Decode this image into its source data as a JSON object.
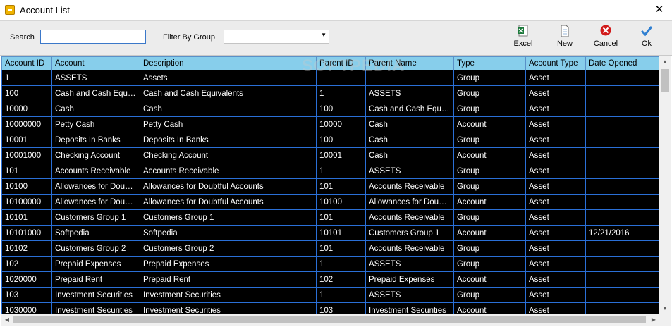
{
  "window": {
    "title": "Account List",
    "close_glyph": "✕"
  },
  "toolbar": {
    "search_label": "Search",
    "search_value": "",
    "filter_label": "Filter By Group",
    "filter_value": "",
    "buttons": [
      {
        "label": "Excel",
        "icon": "excel-icon"
      },
      {
        "label": "New",
        "icon": "new-document-icon"
      },
      {
        "label": "Cancel",
        "icon": "cancel-icon"
      },
      {
        "label": "Ok",
        "icon": "checkmark-icon"
      }
    ]
  },
  "colors": {
    "header_bg": "#87CEEB",
    "grid_bg": "#000000",
    "grid_line": "#2A6FD6",
    "cell_text": "#FFFFFF"
  },
  "watermark": "SOFTPEDIA",
  "table": {
    "columns": [
      "Account ID",
      "Account",
      "Description",
      "Parent ID",
      "Parent Name",
      "Type",
      "Account Type",
      "Date Opened"
    ],
    "rows": [
      [
        "1",
        "ASSETS",
        "Assets",
        "",
        "",
        "Group",
        "Asset",
        ""
      ],
      [
        "100",
        "Cash and Cash Equiva...",
        "Cash and Cash Equivalents",
        "1",
        "ASSETS",
        "Group",
        "Asset",
        ""
      ],
      [
        "10000",
        "Cash",
        "Cash",
        "100",
        "Cash and Cash Equiva...",
        "Group",
        "Asset",
        ""
      ],
      [
        "10000000",
        "Petty Cash",
        "Petty Cash",
        "10000",
        "Cash",
        "Account",
        "Asset",
        ""
      ],
      [
        "10001",
        "Deposits  In Banks",
        "Deposits  In Banks",
        "100",
        "Cash",
        "Group",
        "Asset",
        ""
      ],
      [
        "10001000",
        "Checking Account",
        "Checking Account",
        "10001",
        "Cash",
        "Account",
        "Asset",
        ""
      ],
      [
        "101",
        "Accounts Receivable",
        "Accounts Receivable",
        "1",
        "ASSETS",
        "Group",
        "Asset",
        ""
      ],
      [
        "10100",
        "Allowances for Doubtf...",
        "Allowances for Doubtful Accounts",
        "101",
        "Accounts Receivable",
        "Group",
        "Asset",
        ""
      ],
      [
        "10100000",
        "Allowances for Doubtf...",
        "Allowances for Doubtful Accounts",
        "10100",
        "Allowances for Doubtf...",
        "Account",
        "Asset",
        ""
      ],
      [
        "10101",
        "Customers Group 1",
        "Customers Group 1",
        "101",
        "Accounts Receivable",
        "Group",
        "Asset",
        ""
      ],
      [
        "10101000",
        "Softpedia",
        "Softpedia",
        "10101",
        "Customers Group 1",
        "Account",
        "Asset",
        "12/21/2016"
      ],
      [
        "10102",
        "Customers Group 2",
        "Customers Group 2",
        "101",
        "Accounts Receivable",
        "Group",
        "Asset",
        ""
      ],
      [
        "102",
        "Prepaid Expenses",
        "Prepaid Expenses",
        "1",
        "ASSETS",
        "Group",
        "Asset",
        ""
      ],
      [
        "1020000",
        "Prepaid Rent",
        "Prepaid Rent",
        "102",
        "Prepaid Expenses",
        "Account",
        "Asset",
        ""
      ],
      [
        "103",
        "Investment Securities",
        "Investment Securities",
        "1",
        "ASSETS",
        "Group",
        "Asset",
        ""
      ],
      [
        "1030000",
        "Investment Securities",
        "Investment Securities",
        "103",
        "Investment Securities",
        "Account",
        "Asset",
        ""
      ]
    ]
  }
}
